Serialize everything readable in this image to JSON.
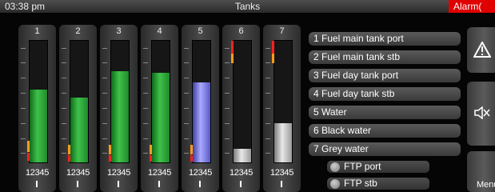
{
  "header": {
    "time": "03:38  pm",
    "title": "Tanks",
    "alarm": "Alarm("
  },
  "tanks": [
    {
      "number": "1",
      "foot": "12345",
      "marker": "I",
      "level": 0.6,
      "color": "green"
    },
    {
      "number": "2",
      "foot": "12345",
      "marker": "I",
      "level": 0.53,
      "color": "green"
    },
    {
      "number": "3",
      "foot": "12345",
      "marker": "I",
      "level": 0.75,
      "color": "green"
    },
    {
      "number": "4",
      "foot": "12345",
      "marker": "I",
      "level": 0.74,
      "color": "green"
    },
    {
      "number": "5",
      "foot": "12345",
      "marker": "I",
      "level": 0.66,
      "color": "blue"
    },
    {
      "number": "6",
      "foot": "12345",
      "marker": "I",
      "level": 0.11,
      "color": "gray"
    },
    {
      "number": "7",
      "foot": "12345",
      "marker": "I",
      "level": 0.32,
      "color": "gray"
    }
  ],
  "labels": [
    "1 Fuel main tank port",
    "2 Fuel main tank stb",
    "3 Fuel day tank port",
    "4 Fuel day tank stb",
    "5 Water",
    "6 Black water",
    "7 Grey water"
  ],
  "ftp": [
    "FTP port",
    "FTP stb"
  ],
  "side_buttons": {
    "menu": "Menu"
  },
  "icons": {
    "warning": "warning-triangle-icon",
    "mute": "speaker-mute-icon"
  }
}
